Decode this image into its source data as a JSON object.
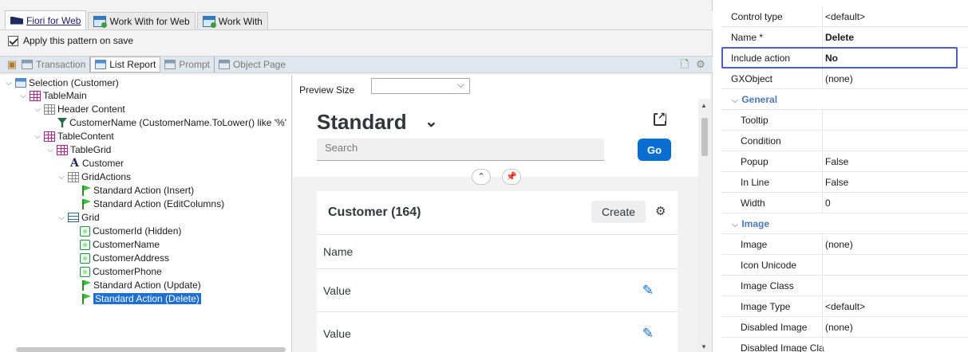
{
  "top_tabs": [
    {
      "label": "Fiori for Web",
      "active": true
    },
    {
      "label": "Work With for Web",
      "active": false
    },
    {
      "label": "Work With",
      "active": false
    }
  ],
  "apply_pattern": {
    "label": "Apply this pattern on save",
    "checked": true
  },
  "sub_tabs": [
    {
      "label": "Transaction",
      "active": false
    },
    {
      "label": "List Report",
      "active": true
    },
    {
      "label": "Prompt",
      "active": false
    },
    {
      "label": "Object Page",
      "active": false
    }
  ],
  "tree": {
    "nodes": [
      {
        "label": "Selection (Customer)",
        "icon": "window-icon"
      },
      {
        "label": "TableMain",
        "icon": "table-icon"
      },
      {
        "label": "Header Content",
        "icon": "grid-icon"
      },
      {
        "label": "CustomerName (CustomerName.ToLower() like '%'",
        "icon": "filter-icon"
      },
      {
        "label": "TableContent",
        "icon": "table-icon"
      },
      {
        "label": "TableGrid",
        "icon": "table-icon"
      },
      {
        "label": "Customer",
        "icon": "text-icon"
      },
      {
        "label": "GridActions",
        "icon": "grid-icon"
      },
      {
        "label": "Standard Action (Insert)",
        "icon": "flag-icon"
      },
      {
        "label": "Standard Action (EditColumns)",
        "icon": "flag-icon"
      },
      {
        "label": "Grid",
        "icon": "list-icon"
      },
      {
        "label": "CustomerId (Hidden)",
        "icon": "attribute-icon"
      },
      {
        "label": "CustomerName",
        "icon": "attribute-icon"
      },
      {
        "label": "CustomerAddress",
        "icon": "attribute-icon"
      },
      {
        "label": "CustomerPhone",
        "icon": "attribute-icon"
      },
      {
        "label": "Standard Action (Update)",
        "icon": "flag-icon"
      },
      {
        "label": "Standard Action (Delete)",
        "icon": "flag-icon",
        "selected": true
      }
    ]
  },
  "preview": {
    "size_label": "Preview Size",
    "size_value": "",
    "variant_title": "Standard",
    "search_placeholder": "Search",
    "go_label": "Go",
    "table_title": "Customer (164)",
    "create_label": "Create",
    "column_header": "Name",
    "rows": [
      "Value",
      "Value"
    ]
  },
  "properties": {
    "rows": [
      {
        "name": "Control type",
        "value": "<default>"
      },
      {
        "name": "Name *",
        "value": "Delete",
        "bold": true
      },
      {
        "name": "Include action",
        "value": "No",
        "bold": true,
        "highlighted": true
      },
      {
        "name": "GXObject",
        "value": "(none)"
      },
      {
        "group": "General"
      },
      {
        "name": "Tooltip",
        "value": ""
      },
      {
        "name": "Condition",
        "value": ""
      },
      {
        "name": "Popup",
        "value": "False"
      },
      {
        "name": "In Line",
        "value": "False"
      },
      {
        "name": "Width",
        "value": "0"
      },
      {
        "group": "Image"
      },
      {
        "name": "Image",
        "value": "(none)"
      },
      {
        "name": "Icon Unicode",
        "value": ""
      },
      {
        "name": "Image Class",
        "value": ""
      },
      {
        "name": "Image Type",
        "value": "<default>"
      },
      {
        "name": "Disabled Image",
        "value": "(none)"
      },
      {
        "name": "Disabled Image Cla",
        "value": ""
      }
    ]
  },
  "colors": {
    "accent": "#0a6ed1",
    "selection": "#1f6fd0",
    "highlight_border": "#4b5fc4",
    "group_text": "#4a79b8"
  }
}
